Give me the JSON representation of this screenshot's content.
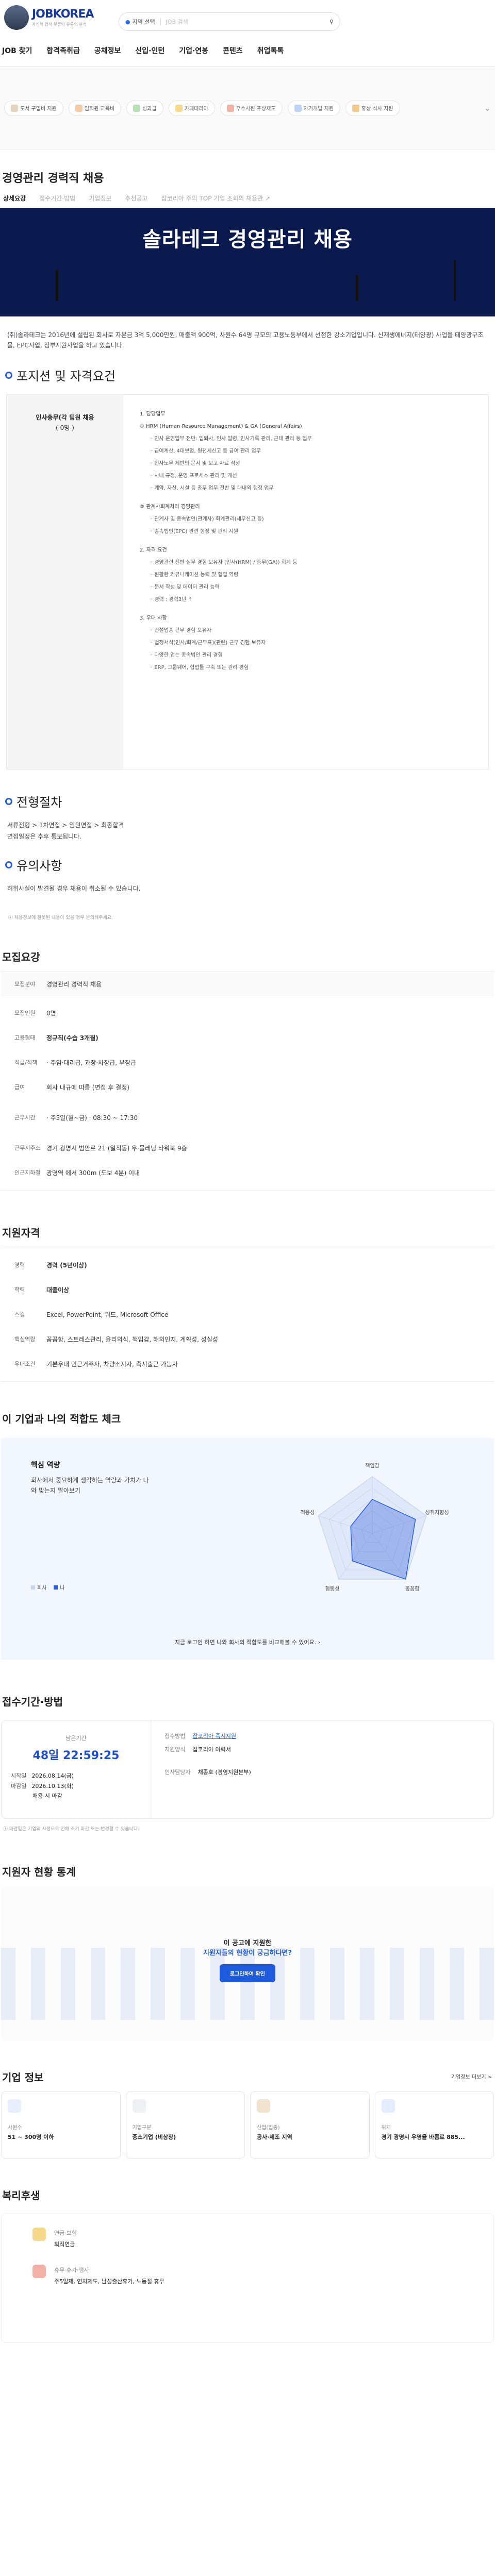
{
  "header": {
    "logo": "JOBKOREA",
    "logo_tag": "자신의 업적 분류와 유통의 분석",
    "location": "지역 선택",
    "search_placeholder": "JOB 검색",
    "nav": [
      "JOB 찾기",
      "합격족취급",
      "공채정보",
      "신입·인턴",
      "기업·연봉",
      "콘텐츠",
      "취업톡톡"
    ]
  },
  "banner_chips": [
    "도서 구입비 지원",
    "임직원 교육비",
    "성과급",
    "카페테리아",
    "우수사원 포상제도",
    "자기개발 지원",
    "휴상 식사 지원"
  ],
  "job_title": "경영관리 경력직 채용",
  "tabs": [
    "상세요강",
    "접수기간·방법",
    "기업정보",
    "추천공고",
    "잡코리아 주의 TOP 기업 조회의 채용관 ↗"
  ],
  "hero_title": "솔라테크 경영관리 채용",
  "intro": "(취)솔라테크는 2016년에 설립된 회사로 자본금 3억 5,000만원, 매출액 900억, 사원수 64명 규모의 고용노동부에서 선정한 강소기업입니다. 신재생에너지(태양광) 사업을 태양광구조물, EPC사업, 정부지원사업을 하고 있습니다.",
  "position_section": "포지션 및 자격요건",
  "position": {
    "role": "인사총무(각 팀원 채용",
    "count": "( 0명 )",
    "lines": [
      {
        "t": "1. 담당업무",
        "c": "hd"
      },
      {
        "t": "① HRM (Human Resource Management) & GA (General Affairs)",
        "c": "hd"
      },
      {
        "t": "· 인사 운영업무 전반: 입퇴사, 인사 발령, 인사기록 관리, 근태 관리 등 업무",
        "c": "li"
      },
      {
        "t": "· 급여계산, 4대보험, 원천세신고 등 급여 관리 업무",
        "c": "li"
      },
      {
        "t": "· 인사노무 제반의 문서 및 보고 자료 작성",
        "c": "li"
      },
      {
        "t": "· 사내 규정, 운영 프로세스 관리 및 개선",
        "c": "li"
      },
      {
        "t": "· 계약, 자산, 시설 등 총무 업무 전반 및 대내외 행정 업무",
        "c": "li"
      },
      {
        "t": "",
        "c": "gap"
      },
      {
        "t": "② 관계사회계처리 경영관리",
        "c": "hd"
      },
      {
        "t": "· 관계사 및 종속법인(관계사) 회계관리(세무신고 등)",
        "c": "li"
      },
      {
        "t": "· 종속법인(EPC) 관련 행정 및 관리 지원",
        "c": "li"
      },
      {
        "t": "",
        "c": "gap"
      },
      {
        "t": "2. 자격 요건",
        "c": "hd"
      },
      {
        "t": "· 경영관련 전반 실무 경험 보유자 (인사(HRM) / 총무(GA)) 회계 등",
        "c": "li"
      },
      {
        "t": "· 원활한 커뮤니케이션 능력 및 협업 역량",
        "c": "li"
      },
      {
        "t": "· 문서 작성 및 데이터 관리 능력",
        "c": "li"
      },
      {
        "t": "· 경력 : 경력3년 ↑",
        "c": "li"
      },
      {
        "t": "",
        "c": "gap"
      },
      {
        "t": "3. 우대 사항",
        "c": "hd"
      },
      {
        "t": "· 건설업종 근무 경험 보유자",
        "c": "li"
      },
      {
        "t": "· 법정서식(인사/회계/근무표)(관련) 근무 경험 보유자",
        "c": "li"
      },
      {
        "t": "· 다양한 업는 종속법인 관리 경험",
        "c": "li"
      },
      {
        "t": "· ERP, 그룹웨어, 협업툴 구축 또는 관리 경험",
        "c": "li"
      }
    ]
  },
  "process_section": "전형절차",
  "process_lines": [
    "서류전형 > 1차면접 > 임원면접 > 최종합격",
    "면접일정은 추후 통보됩니다."
  ],
  "notice_section": "유의사항",
  "notice_lines": [
    "허위사실이 발견될 경우 채용이 취소될 수 있습니다."
  ],
  "disclaimer": "채용정보에 잘못된 내용이 있을 경우 문의해주세요.",
  "summary_title": "모집요강",
  "summary": [
    {
      "k": "모집분야",
      "v": "경영관리 경력직 채용"
    },
    {
      "k": "모집인원",
      "v": "0명"
    },
    {
      "k": "고용형태",
      "v": "정규직(수습 3개월)"
    },
    {
      "k": "직급/직책",
      "v": "· 주임·대리급, 과장·차장급, 부장급"
    },
    {
      "k": "급여",
      "v": "회사 내규에 따름 (면접 후 결정)"
    },
    {
      "k": "근무시간",
      "v": "· 주5일(월~금)  · 08:30 ~ 17:30"
    },
    {
      "k": "근무지주소",
      "v": "경기 광명시 범안로 21 (일직동) 우·몰레닝 타워북 9층"
    },
    {
      "k": "인근지하철",
      "v": "광명역 에서 300m (도보 4분) 이내"
    }
  ],
  "qual_title": "지원자격",
  "qual": [
    {
      "k": "경력",
      "v": "경력 (5년이상)"
    },
    {
      "k": "학력",
      "v": "대졸이상"
    },
    {
      "k": "스킬",
      "v": "Excel, PowerPoint, 워드, Microsoft Office"
    },
    {
      "k": "핵심역량",
      "v": "꼼꼼함, 스트레스관리, 윤리의식, 책임감, 해외인지, 계획성, 성실성"
    },
    {
      "k": "우대조건",
      "v": "기본우대  인근거주자, 차량소지자, 즉시출근 가능자"
    }
  ],
  "fit_title": "이 기업과 나의 적합도 체크",
  "fit": {
    "label": "핵심 역량",
    "desc": "회사에서 중요하게 생각하는 역량과 가치가 나와 맞는지 알아보기",
    "legend_company": "회사",
    "legend_me": "나",
    "login_text": "지금 로그인 하면 나와 회사의 적합도를 비교해볼 수 있어요."
  },
  "chart_data": {
    "type": "radar",
    "categories": [
      "책임감",
      "성취지향성",
      "꼼꼼함",
      "협동성",
      "적응성"
    ],
    "series": [
      {
        "name": "회사",
        "values": [
          5,
          5,
          5,
          5,
          5
        ]
      },
      {
        "name": "나",
        "values": [
          3,
          4,
          5,
          3,
          2
        ]
      }
    ]
  },
  "apply_title": "접수기간·방법",
  "apply": {
    "remain_label": "남은기간",
    "remain": "48일 22:59:25",
    "start_label": "시작일",
    "start": "2026.08.14(금)",
    "end_label": "마감일",
    "end": "2026.10.13(화)",
    "note": "채용 시 마감",
    "rows": [
      {
        "k": "접수방법",
        "v": "잡코리아 즉시지원"
      },
      {
        "k": "지원양식",
        "v": "잡코리아 이력서"
      },
      {
        "k": "인사담당자",
        "v": "채종호 (경영지원본부)"
      }
    ]
  },
  "apply_note": "마감일은 기업의 사정으로 인해 조기 마감 또는 변경될 수 있습니다.",
  "stats_title": "지원자 현황 통계",
  "stats_popup": {
    "line1": "이 공고에 지원한",
    "line2": "지원자들의 현황이 궁금하다면?",
    "button": "로그인하여 확인"
  },
  "company_title": "기업 정보",
  "company_link": "기업정보 더보기 >",
  "company_cards": [
    {
      "k": "사원수",
      "v": "51 ~ 300명 이하"
    },
    {
      "k": "기업구분",
      "v": "중소기업 (비상장)"
    },
    {
      "k": "산업(업종)",
      "v": "공사·제조 지역"
    },
    {
      "k": "위치",
      "v": "경기 광명시 우영을 바롬로 885..."
    }
  ],
  "benefit_title": "복리후생",
  "benefits": [
    {
      "k": "연금·보험",
      "v": "퇴직연금"
    },
    {
      "k": "휴무·휴가·행사",
      "v": "주5일제, 연차제도, 남성출산휴가, 노동절 휴무"
    }
  ]
}
